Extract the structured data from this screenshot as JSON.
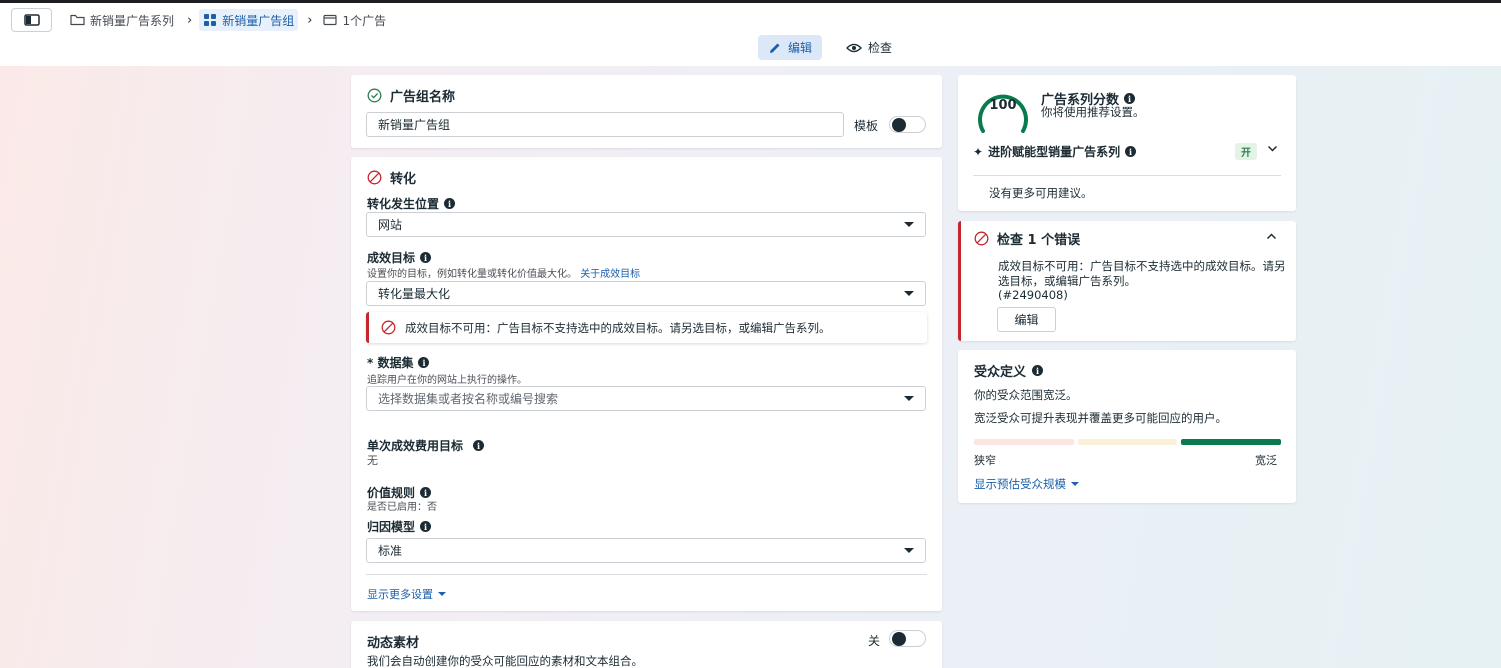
{
  "breadcrumb": {
    "campaign": "新销量广告系列",
    "adset": "新销量广告组",
    "ad": "1个广告"
  },
  "modes": {
    "edit": "编辑",
    "review": "检查"
  },
  "adset_name": {
    "title": "广告组名称",
    "value": "新销量广告组",
    "template_label": "模板",
    "template_on": false
  },
  "conversion": {
    "title": "转化",
    "location_label": "转化发生位置",
    "location_value": "网站",
    "goal_label": "成效目标",
    "goal_desc": "设置你的目标，例如转化量或转化价值最大化。",
    "goal_link": "关于成效目标",
    "goal_value": "转化量最大化",
    "goal_error": "成效目标不可用：广告目标不支持选中的成效目标。请另选目标，或编辑广告系列。",
    "dataset_label": "* 数据集",
    "dataset_desc": "追踪用户在你的网站上执行的操作。",
    "dataset_placeholder": "选择数据集或者按名称或编号搜索",
    "cost_label": "单次成效费用目标",
    "cost_value": "无",
    "value_rules_label": "价值规则",
    "value_rules_status": "是否已启用：否",
    "attribution_label": "归因模型",
    "attribution_value": "标准",
    "more_settings": "显示更多设置"
  },
  "dynamic": {
    "title": "动态素材",
    "toggle_label": "关",
    "toggle_on": false,
    "desc": "我们会自动创建你的受众可能回应的素材和文本组合。"
  },
  "score": {
    "value": "100",
    "title": "广告系列分数",
    "subtitle": "你将使用推荐设置。",
    "advantage_label": "进阶赋能型销量广告系列",
    "advantage_badge": "开",
    "no_more": "没有更多可用建议。"
  },
  "errors": {
    "title": "检查 1 个错误",
    "message": "成效目标不可用：广告目标不支持选中的成效目标。请另选目标，或编辑广告系列。",
    "code": "(#2490408)",
    "edit_button": "编辑"
  },
  "audience": {
    "title": "受众定义",
    "status": "你的受众范围宽泛。",
    "desc": "宽泛受众可提升表现并覆盖更多可能回应的用户。",
    "narrow": "狭窄",
    "broad": "宽泛",
    "level": "broad",
    "show_size": "显示预估受众规模"
  },
  "colors": {
    "accent": "#1d5fa8",
    "error": "#c4262e",
    "success": "#2e7d4f",
    "score_ring": "#0a7b4f"
  }
}
